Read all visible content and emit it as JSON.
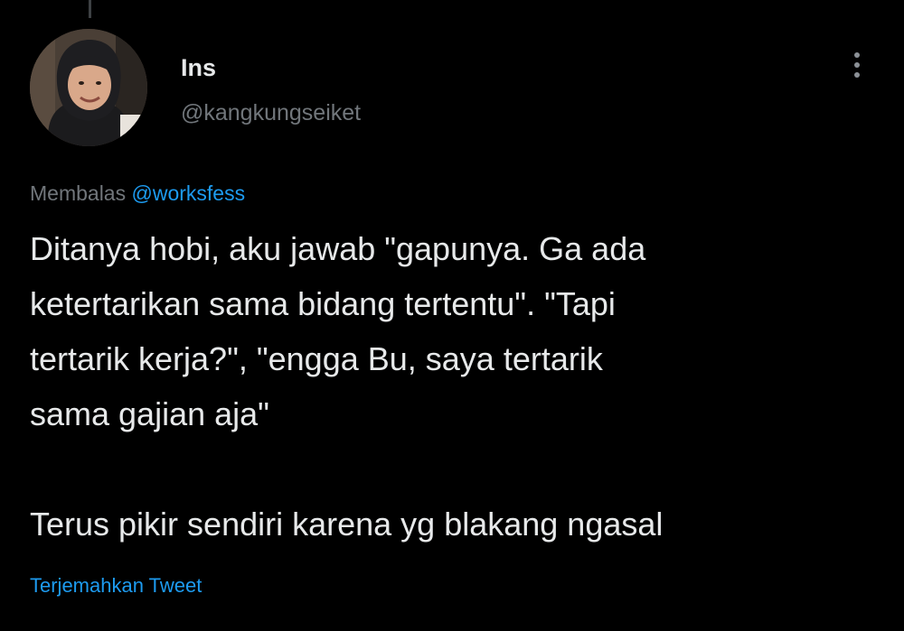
{
  "user": {
    "display_name": "Ins",
    "handle": "@kangkungseiket"
  },
  "more_menu": {
    "icon": "more-vertical-icon"
  },
  "reply": {
    "prefix": "Membalas",
    "mention": "@worksfess"
  },
  "tweet": {
    "lines": [
      "Ditanya hobi, aku jawab \"gapunya. Ga ada",
      "ketertarikan sama bidang tertentu\". \"Tapi",
      "tertarik kerja?\", \"engga Bu, saya tertarik",
      "sama gajian aja\""
    ],
    "last_line": "Terus pikir sendiri karena yg blakang ngasal"
  },
  "translate_label": "Terjemahkan Tweet",
  "colors": {
    "background": "#000000",
    "text": "#e7e9ea",
    "muted": "#71767b",
    "accent": "#1d9bf0"
  }
}
